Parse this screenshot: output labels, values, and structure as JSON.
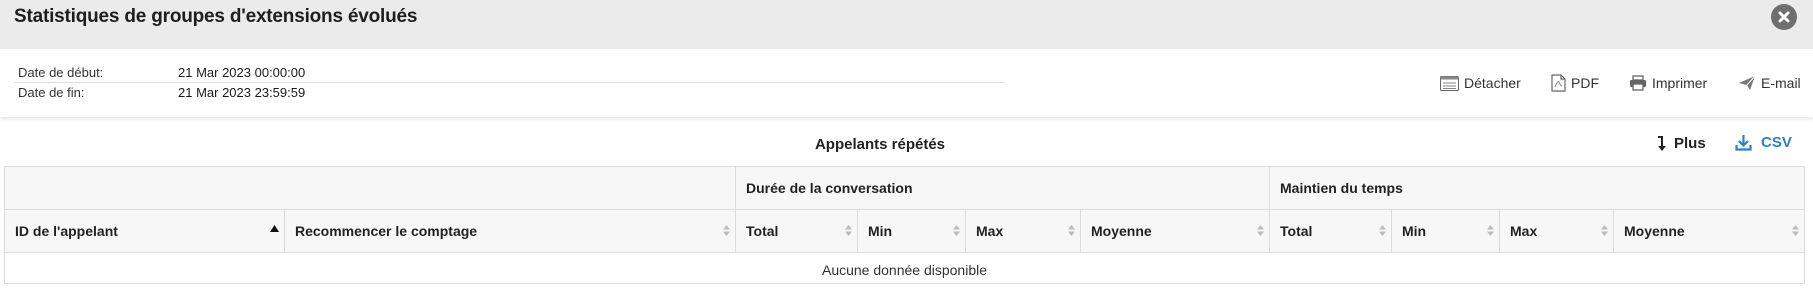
{
  "dialog": {
    "title": "Statistiques de groupes d'extensions évolués",
    "close_icon": "close-circle-icon"
  },
  "dates": [
    {
      "label": "Date de début:",
      "value": "21 Mar 2023 00:00:00"
    },
    {
      "label": "Date de fin:",
      "value": "21 Mar 2023 23:59:59"
    }
  ],
  "toolbar": {
    "detach_label": "Détacher",
    "pdf_label": "PDF",
    "print_label": "Imprimer",
    "email_label": "E-mail"
  },
  "section": {
    "title": "Appelants répétés",
    "plus_label": "Plus",
    "csv_label": "CSV"
  },
  "colors": {
    "accent": "#2a7fd4",
    "header_bg": "#ebebeb",
    "table_header_bg": "#f7f7f7",
    "border": "#dcdcdc"
  },
  "table": {
    "group_headers": [
      "",
      "Durée de la conversation",
      "Maintien du temps"
    ],
    "columns": [
      "ID de l'appelant",
      "Recommencer le comptage",
      "Total",
      "Min",
      "Max",
      "Moyenne",
      "Total",
      "Min",
      "Max",
      "Moyenne"
    ],
    "sorted_column": "ID de l'appelant",
    "sort_direction": "ascending",
    "empty_message": "Aucune donnée disponible",
    "rows": []
  }
}
